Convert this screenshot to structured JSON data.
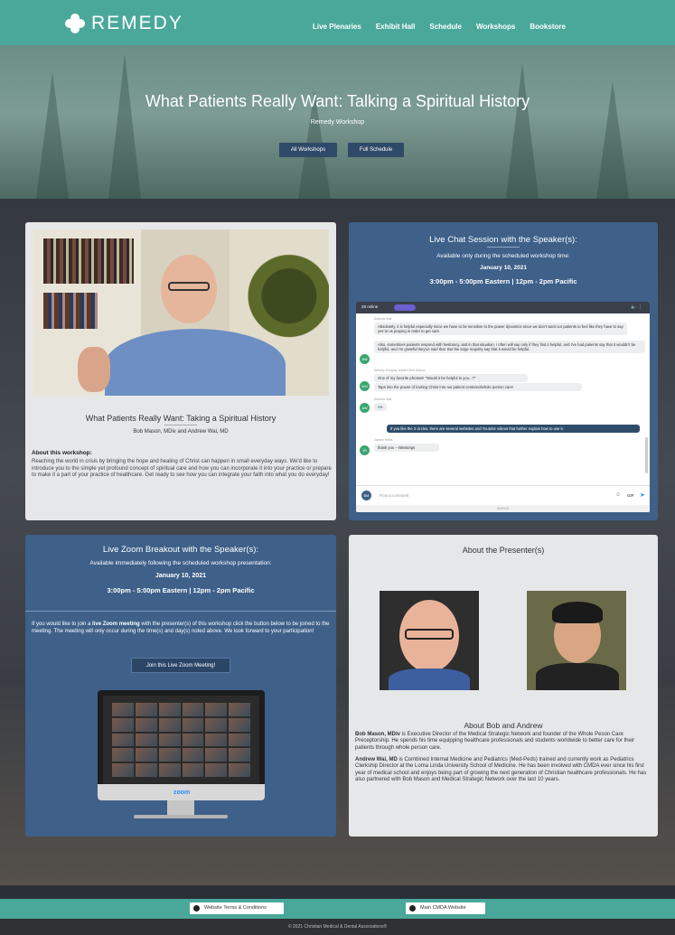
{
  "nav": {
    "brand": "REMEDY",
    "links": [
      "Live Plenaries",
      "Exhibit Hall",
      "Schedule",
      "Workshops",
      "Bookstore"
    ]
  },
  "hero": {
    "title": "What Patients Really Want: Talking a Spiritual History",
    "subtitle": "Remedy Workshop",
    "btn_all": "All Workshops",
    "btn_schedule": "Full Schedule"
  },
  "workshop": {
    "title": "What Patients Really Want: Taking a Spiritual History",
    "speakers": "Bob Mason, MDiv and Andrew Wai, MD",
    "about_heading": "About this workshop:",
    "about_text": "Reaching the world in crisis by bringing the hope and healing of Christ can happen in small everyday ways. We'd like to introduce you to the simple yet profound concept of spiritual care and how you can incorporate it into your practice or prepare to make it a part of your practice of healthcare. Get ready to see how you can integrate your faith into what you do everyday!"
  },
  "chat": {
    "title": "Live Chat Session with the Speaker(s):",
    "availability": "Available only during the scheduled workshop time:",
    "date": "January 10, 2021",
    "time": "3:00pm - 5:00pm Eastern | 12pm - 2pm Pacific",
    "online": "28 online",
    "messages": {
      "m1_meta": "Andrew Wai",
      "m1": "Absolutely, it is helpful especially since we have to be sensitive to the power dynamics since we don't want our patients to feel like they have to say yes to us praying in order to get care.",
      "m2": "Also, sometimes patients respond with hesitancy, and in that situation, I often will say only if they find it helpful, and I've had patients say that it wouldn't be helpful, and I'm grateful they've said that. But the large majority say that it would be helpful.",
      "m3_meta": "Wesley Gregory replied Bob Mason",
      "m3": "One of my favorite phrases! \"Would it be helpful to you...?\"",
      "m4": "Taps into the power of inviting Christ into our patient centered/whole person care!",
      "m5_meta": "Andrew Wai",
      "m5": "AA",
      "m6": "If you like the 3 circles, there are several websites and Youtube videos that further explain how to use it.",
      "m7_meta": "James Hellie",
      "m7": "thank you -- Blessings"
    },
    "input_placeholder": "Post a comment",
    "gif": "GIF",
    "powered": "ONESIG"
  },
  "zoom": {
    "title": "Live Zoom Breakout with the Speaker(s):",
    "availability": "Available immediately following the scheduled workshop presentation:",
    "date": "January 10, 2021",
    "time": "3:00pm - 5:00pm Eastern | 12pm - 2pm Pacific",
    "description_pre": "If you would like to join a ",
    "description_bold": "live Zoom meeting",
    "description_post": " with the presenter(s) of this workshop click the button below to be joined to the meeting. The meeting will only occur during the time(s) and day(s) noted above. We look forward to your participation!",
    "button": "Join this Live Zoom Meeting!",
    "logo": "zoom"
  },
  "presenters": {
    "title": "About the Presenter(s)",
    "heading": "About Bob and Andrew",
    "bio1_name": "Bob Mason, MDiv",
    "bio1": " is Executive Director of the Medical Strategic Network and founder of the Whole Peson Care Preceptorship. He spends his time equipping healthcare professionals and students worldwide to better care for their patients through whole person care.",
    "bio2_name": "Andrew Wai, MD",
    "bio2": " is Combined Internal Medicine and Pediatrics (Med-Peds) trained and currently work as Pediatrics Clerkship Director at the Loma Linda University School of Medicine. He has been involved with CMDA ever since his first year of medical school and enjoys being part of growing the next generation of Christian healthcare professionals. He has also partnered with Bob Mason and Medical Strategic Network over the last 10 years."
  },
  "footer": {
    "terms": "Website Terms & Conditions",
    "cmda": "Main CMDA Website",
    "copyright": "© 2021 Christian Medical & Dental Associations®"
  }
}
